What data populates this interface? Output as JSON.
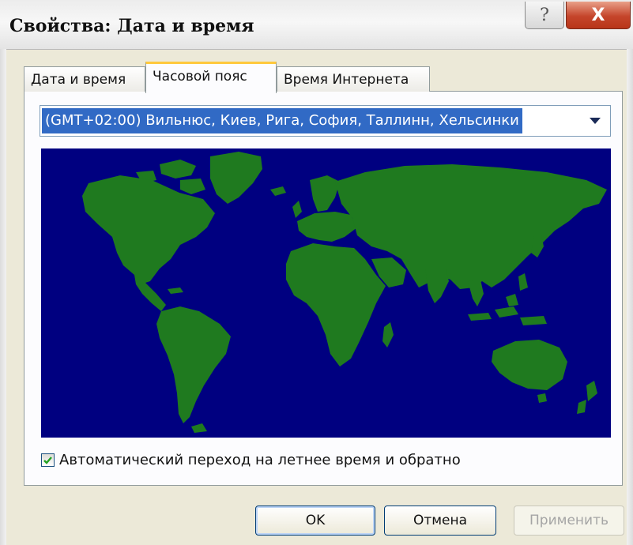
{
  "window": {
    "title": "Свойства: Дата и время",
    "help_glyph": "?",
    "close_glyph": "X"
  },
  "tabs": [
    {
      "label": "Дата и время",
      "active": false
    },
    {
      "label": "Часовой пояс",
      "active": true
    },
    {
      "label": "Время Интернета",
      "active": false
    }
  ],
  "timezone": {
    "selected": "(GMT+02:00) Вильнюс, Киев, Рига, София, Таллинн, Хельсинки"
  },
  "map": {
    "ocean_color": "#000080",
    "land_color": "#1f7a1f"
  },
  "dst_checkbox": {
    "label": "Автоматический переход на летнее время и обратно",
    "checked": true
  },
  "buttons": {
    "ok": "OK",
    "cancel": "Отмена",
    "apply": "Применить"
  },
  "colors": {
    "selection": "#316ac5",
    "active_tab_accent": "#ffc83c"
  }
}
